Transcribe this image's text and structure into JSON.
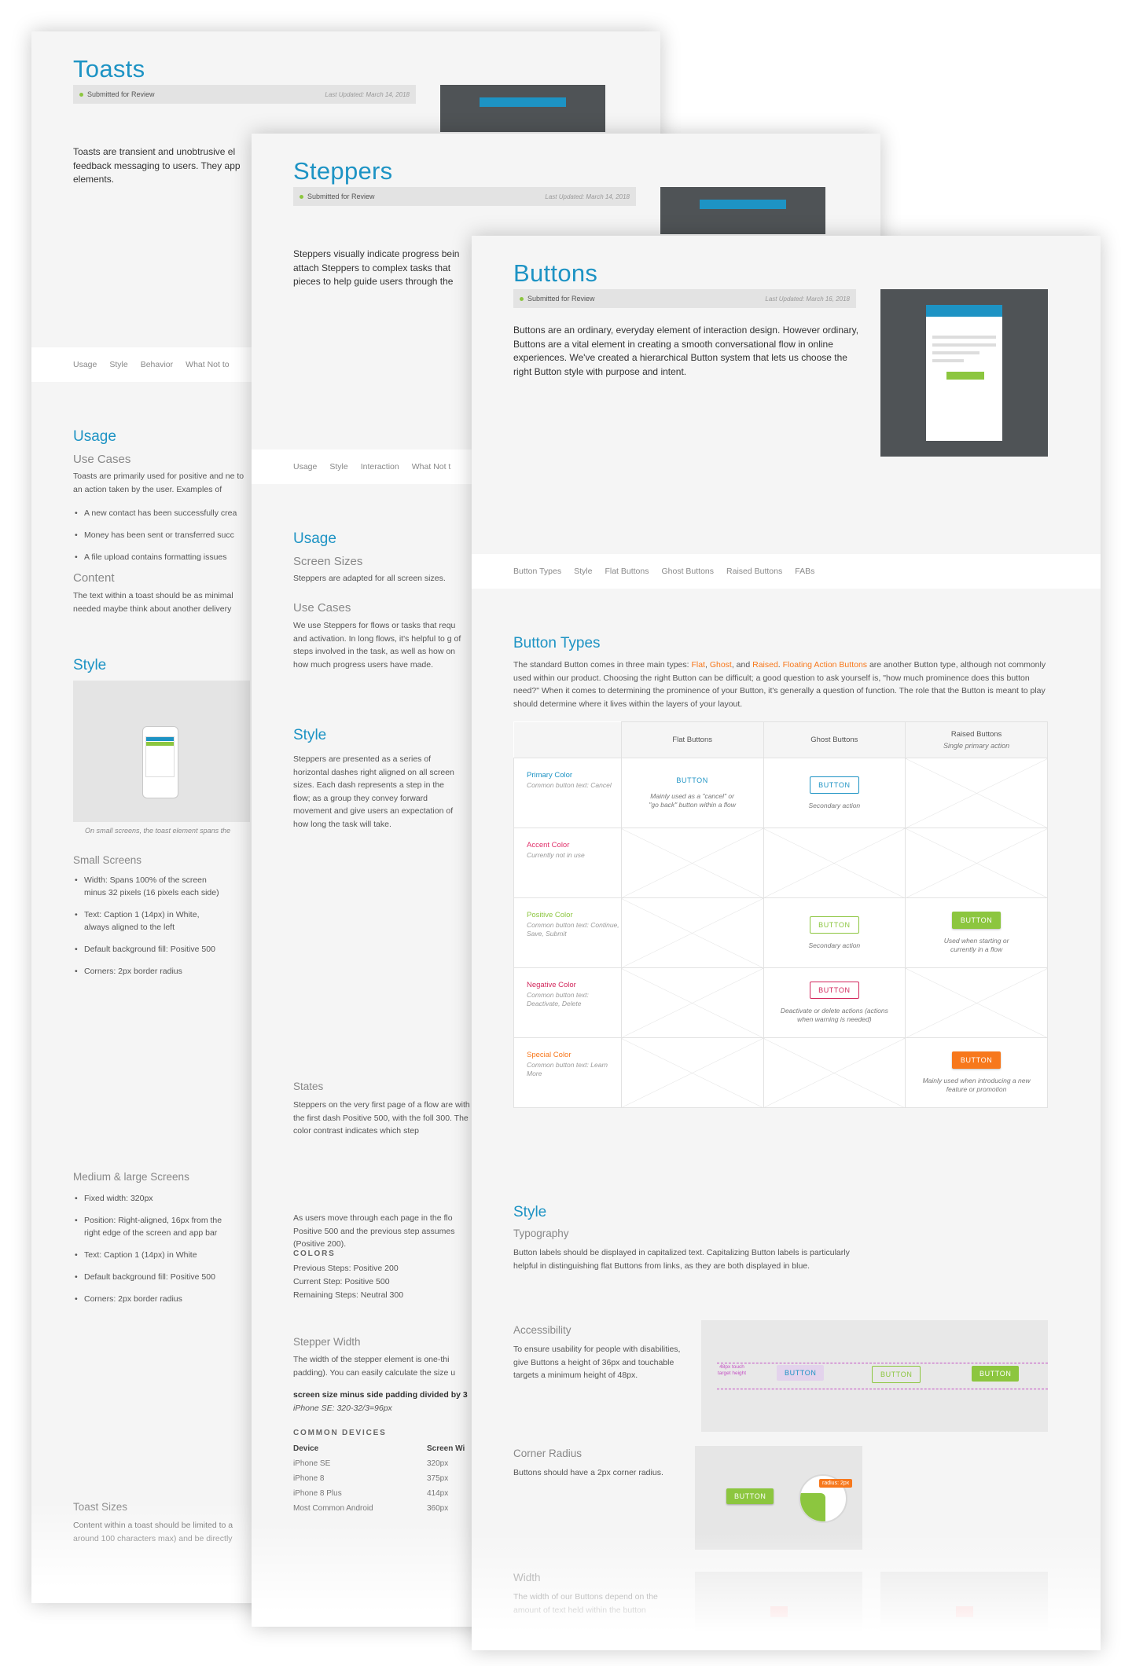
{
  "colors": {
    "blue": "#1d93c4",
    "green": "#8cc63f",
    "orange": "#f7781c",
    "magenta": "#d2275c",
    "accent_red": "#e0306a",
    "preview_bg": "#4f5356"
  },
  "toasts": {
    "title": "Toasts",
    "status": "Submitted for Review",
    "updated": "Last Updated: March 14, 2018",
    "intro": "Toasts are transient and unobtrusive el feedback messaging to users. They app elements.",
    "nav": [
      "Usage",
      "Style",
      "Behavior",
      "What Not to"
    ],
    "usage": {
      "heading": "Usage",
      "use_cases_title": "Use Cases",
      "use_cases_body": "Toasts are primarily used for positive and ne to an action taken by the user. Examples of",
      "bullets": [
        "A new contact has been successfully crea",
        "Money has been sent or transferred succ",
        "A file upload contains formatting issues"
      ],
      "content_title": "Content",
      "content_body": "The text within a toast should be as minimal needed maybe think about another delivery"
    },
    "style": {
      "heading": "Style",
      "image_caption": "On small screens, the toast element spans the",
      "small_title": "Small Screens",
      "small_bullets": [
        "Width: Spans 100% of the screen minus 32 pixels (16 pixels each side)",
        "Text: Caption 1 (14px) in White, always aligned to the left",
        "Default background fill: Positive 500",
        "Corners: 2px border radius"
      ],
      "medium_title": "Medium & large Screens",
      "medium_bullets": [
        "Fixed width: 320px",
        "Position: Right-aligned, 16px from the right edge of the screen and app bar",
        "Text: Caption 1 (14px) in White",
        "Default background fill: Positive 500",
        "Corners: 2px border radius"
      ],
      "sizes_title": "Toast Sizes",
      "sizes_body": "Content within a toast should be limited to a around 100 characters max) and be directly"
    }
  },
  "steppers": {
    "title": "Steppers",
    "status": "Submitted for Review",
    "updated": "Last Updated: March 14, 2018",
    "intro": "Steppers visually indicate progress bein attach Steppers to complex tasks that pieces to help guide users through the",
    "nav": [
      "Usage",
      "Style",
      "Interaction",
      "What Not t"
    ],
    "usage": {
      "heading": "Usage",
      "screen_sizes_title": "Screen Sizes",
      "screen_sizes_body": "Steppers are adapted for all screen sizes.",
      "use_cases_title": "Use Cases",
      "use_cases_body": "We use Steppers for flows or tasks that requ and activation. In long flows, it's helpful to g of steps involved in the task, as well as how on how much progress users have made."
    },
    "style": {
      "heading": "Style",
      "body": "Steppers are presented as a series of horizontal dashes right aligned on all screen sizes. Each dash represents a step in the flow; as a group they convey forward movement and give users an expectation of how long the task will take.",
      "states_title": "States",
      "states_body": "Steppers on the very first page of a flow are with the first dash Positive 500, with the foll 300. The color contrast indicates which step",
      "move_body": "As users move through each page in the flo Positive 500 and the previous step assumes (Positive 200).",
      "colors_title": "COLORS",
      "colors_lines": [
        "Previous Steps: Positive 200",
        "Current Step: Positive 500",
        "Remaining Steps: Neutral 300"
      ],
      "width_title": "Stepper Width",
      "width_body": "The width of the stepper element is one-thi padding). You can easily calculate the size u",
      "formula_bold": "screen size minus side padding divided by 3",
      "formula_example": "iPhone SE: 320-32/3=96px",
      "devices_title": "COMMON DEVICES",
      "devices_header": [
        "Device",
        "Screen Wi"
      ],
      "devices": [
        [
          "iPhone SE",
          "320px"
        ],
        [
          "iPhone 8",
          "375px"
        ],
        [
          "iPhone 8 Plus",
          "414px"
        ],
        [
          "Most Common Android",
          "360px"
        ]
      ]
    }
  },
  "buttons": {
    "title": "Buttons",
    "status": "Submitted for Review",
    "updated": "Last Updated: March 16, 2018",
    "intro": "Buttons are an ordinary, everyday element of interaction design. However ordinary, Buttons are a vital element in creating a smooth conversational flow in online experiences. We've created a hierarchical Button system that lets us choose the right Button style with purpose and intent.",
    "nav": [
      "Button Types",
      "Style",
      "Flat Buttons",
      "Ghost Buttons",
      "Raised Buttons",
      "FABs"
    ],
    "types": {
      "heading": "Button Types",
      "body_a": "The standard Button comes in three main types: ",
      "flat": "Flat",
      "sep1": ", ",
      "ghost": "Ghost",
      "sep2": ", and ",
      "raised": "Raised",
      "sep3": ". ",
      "fab": "Floating Action Buttons",
      "body_b": " are another Button type, although not commonly used within our product. Choosing the right Button can be difficult; a good question to ask yourself is, \"how much prominence does this button need?\" When it comes to determining the prominence of your Button, it's generally a question of function. The role that the Button is meant to play should determine where it lives within the layers of your layout."
    },
    "matrix": {
      "col_flat": "Flat Buttons",
      "col_ghost": "Ghost Buttons",
      "col_raised": "Raised Buttons",
      "col_raised_sub": "Single primary action",
      "button_label": "BUTTON",
      "rows": [
        {
          "name": "Primary Color",
          "note": "Common button text: Cancel",
          "flat_note": "Mainly used as a \"cancel\" or \"go back\" button within a flow",
          "ghost_note": "Secondary action"
        },
        {
          "name": "Accent Color",
          "note": "Currently not in use"
        },
        {
          "name": "Positive Color",
          "note": "Common button text: Continue, Save, Submit",
          "ghost_note": "Secondary action",
          "raised_note": "Used when starting or currently in a flow"
        },
        {
          "name": "Negative Color",
          "note": "Common button text: Deactivate, Delete",
          "ghost_note": "Deactivate or delete actions (actions when warning is needed)"
        },
        {
          "name": "Special Color",
          "note": "Common button text: Learn More",
          "raised_note": "Mainly used when introducing a new feature or promotion"
        }
      ]
    },
    "style": {
      "heading": "Style",
      "typography_title": "Typography",
      "typography_body": "Button labels should be displayed in capitalized text. Capitalizing Button labels is particularly helpful in distinguishing flat Buttons from links, as they are both displayed in blue.",
      "accessibility_title": "Accessibility",
      "accessibility_body": "To ensure usability for people with disabilities, give Buttons a height of 36px and touchable targets a minimum height of 48px.",
      "touch_label": "48px touch target height",
      "corner_title": "Corner Radius",
      "corner_body": "Buttons should have a 2px corner radius.",
      "radius_label": "radius: 2px",
      "width_title": "Width",
      "width_body": "The width of our Buttons depend on the amount of text held within the button"
    }
  }
}
